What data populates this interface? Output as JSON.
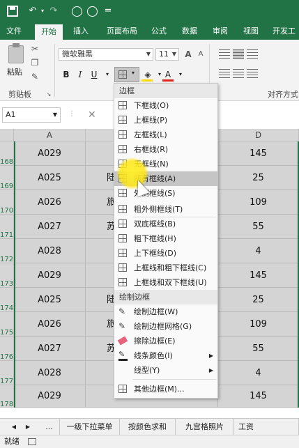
{
  "quick_access": {
    "more": "="
  },
  "tabs": [
    "文件",
    "开始",
    "插入",
    "页面布局",
    "公式",
    "数据",
    "审阅",
    "视图",
    "开发工"
  ],
  "ribbon": {
    "clipboard_label": "剪贴板",
    "paste_label": "粘贴",
    "font_name": "微软雅黑",
    "font_size": "11",
    "bold": "B",
    "italic": "I",
    "underline": "U",
    "font_color_letter": "A",
    "align_label": "对齐方式"
  },
  "formula_bar": {
    "name_box": "A1",
    "cancel": "✕"
  },
  "columns": [
    "A",
    "D"
  ],
  "rows": [
    {
      "num": "168",
      "a": "A029",
      "b": "",
      "d": "145"
    },
    {
      "num": "169",
      "a": "A025",
      "b": "陆",
      "d": "25"
    },
    {
      "num": "170",
      "a": "A026",
      "b": "旅",
      "d": "109"
    },
    {
      "num": "171",
      "a": "A027",
      "b": "苏",
      "d": "55"
    },
    {
      "num": "172",
      "a": "A028",
      "b": "",
      "d": "4"
    },
    {
      "num": "173",
      "a": "A029",
      "b": "",
      "d": "145"
    },
    {
      "num": "174",
      "a": "A025",
      "b": "陆",
      "d": "25"
    },
    {
      "num": "175",
      "a": "A026",
      "b": "旅",
      "d": "109"
    },
    {
      "num": "176",
      "a": "A027",
      "b": "苏",
      "d": "55"
    },
    {
      "num": "177",
      "a": "A028",
      "b": "",
      "d": "4"
    },
    {
      "num": "178",
      "a": "A029",
      "b": "",
      "d": "145"
    }
  ],
  "sheet_tabs": [
    "...",
    "一级下拉菜单",
    "按颜色求和",
    "九宫格照片",
    "工资"
  ],
  "sheet_nav": {
    "prev": "◀",
    "next": "▶"
  },
  "status": "就绪",
  "border_menu": {
    "section1": "边框",
    "items1": [
      "下框线(O)",
      "上框线(P)",
      "左框线(L)",
      "右框线(R)",
      "无框线(N)",
      "所有框线(A)",
      "外侧框线(S)",
      "粗外侧框线(T)",
      "双底框线(B)",
      "粗下框线(H)",
      "上下框线(D)",
      "上框线和粗下框线(C)",
      "上框线和双下框线(U)"
    ],
    "section2": "绘制边框",
    "items2": [
      "绘制边框(W)",
      "绘制边框网格(G)",
      "擦除边框(E)",
      "线条颜色(I)",
      "线型(Y)",
      "其他边框(M)..."
    ],
    "highlighted": "所有框线(A)"
  }
}
